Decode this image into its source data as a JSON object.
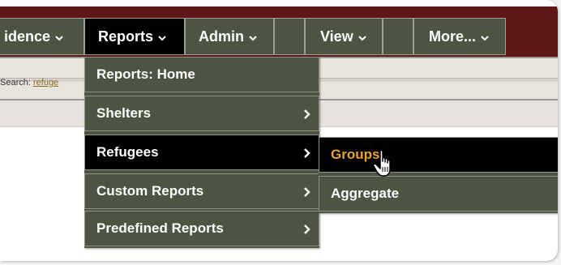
{
  "nav": {
    "items": [
      {
        "label": "idence",
        "has_dropdown": true
      },
      {
        "label": "Reports",
        "has_dropdown": true,
        "active": true
      },
      {
        "label": "Admin",
        "has_dropdown": true
      },
      {
        "label": "",
        "has_dropdown": false
      },
      {
        "label": "View",
        "has_dropdown": true
      },
      {
        "label": "",
        "has_dropdown": false
      },
      {
        "label": "More...",
        "has_dropdown": true
      }
    ]
  },
  "search": {
    "label": "Search:",
    "link_text": "refuge"
  },
  "reports_menu": {
    "items": [
      {
        "label": "Reports: Home",
        "submenu": false
      },
      {
        "label": "Shelters",
        "submenu": true
      },
      {
        "label": "Refugees",
        "submenu": true,
        "highlighted": true
      },
      {
        "label": "Custom Reports",
        "submenu": true
      },
      {
        "label": "Predefined Reports",
        "submenu": true
      }
    ]
  },
  "refugees_submenu": {
    "items": [
      {
        "label": "Groups",
        "highlighted": true
      },
      {
        "label": "Aggregate"
      }
    ]
  },
  "colors": {
    "header_bg": "#5e1616",
    "menu_bg": "#4c5542",
    "menu_highlight": "#000000",
    "submenu_highlight_text": "#e9a330",
    "link": "#8a6a1e"
  },
  "icons": {
    "dropdown": "chevron-down-icon",
    "submenu": "chevron-right-icon",
    "pointer": "hand-pointer-icon"
  }
}
